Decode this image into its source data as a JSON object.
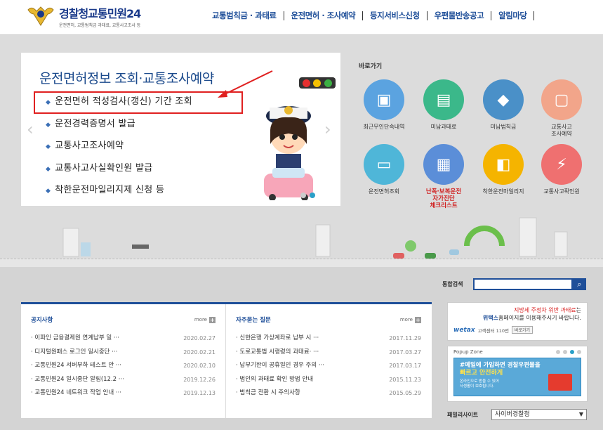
{
  "header": {
    "logo_title_a": "경찰청",
    "logo_title_b": "교통민원24",
    "logo_sub": "운전면허, 교통범칙금 과태료, 교통사고조사 등",
    "nav": [
      "교통범칙금 · 과태료",
      "운전면허 · 조사예약",
      "등지서비스신청",
      "우편물반송공고",
      "알림마당"
    ]
  },
  "banner": {
    "title": "운전면허정보 조회·교통조사예약",
    "items": [
      "운전면허 적성검사(갱신) 기간 조회",
      "운전경력증명서 발급",
      "교통사고조사예약",
      "교통사고사실확인원 발급",
      "착한운전마일리지제 신청 등"
    ],
    "prev_icon": "chevron-left-icon",
    "next_icon": "chevron-right-icon"
  },
  "quick": {
    "title": "바로가기",
    "items": [
      {
        "label": "최근무인단속내역",
        "icon": "camera-icon",
        "color": "#5ba3e0"
      },
      {
        "label": "미납과태료",
        "icon": "money-icon",
        "color": "#3bb88a"
      },
      {
        "label": "미납범칙금",
        "icon": "warning-icon",
        "color": "#4a90c8"
      },
      {
        "label": "교통사고\n조사예약",
        "icon": "computer-icon",
        "color": "#f2a58a"
      },
      {
        "label": "운전면허조회",
        "icon": "id-card-icon",
        "color": "#4fb6d8"
      },
      {
        "label": "난폭·보복운전\n자가진단\n체크리스트",
        "icon": "checklist-icon",
        "color": "#5b8ed8"
      },
      {
        "label": "착한운전마일리지",
        "icon": "mileage-icon",
        "color": "#f5b400"
      },
      {
        "label": "교통사고확인원",
        "icon": "accident-icon",
        "color": "#ef7070"
      }
    ]
  },
  "search": {
    "label": "통합검색",
    "placeholder": "",
    "button_icon": "search-icon"
  },
  "notices": {
    "title": "공지사항",
    "more": "more",
    "rows": [
      {
        "title": "이파인 금융결제원 연계납부 일 ···",
        "date": "2020.02.27"
      },
      {
        "title": "디지털원패스 로그인 일시중단 ···",
        "date": "2020.02.21"
      },
      {
        "title": "교통민원24 서버부하 테스트 안 ···",
        "date": "2020.02.10"
      },
      {
        "title": "교통민원24 일시중단 알림(12.2 ···",
        "date": "2019.12.26"
      },
      {
        "title": "교통민원24 네트워크 작업 안내 ···",
        "date": "2019.12.13"
      }
    ]
  },
  "faq": {
    "title": "자주묻는 질문",
    "more": "more",
    "rows": [
      {
        "title": "신한은행 가상계좌로 납부 시 ···",
        "date": "2017.11.29"
      },
      {
        "title": "도로교통법 시행령의 과태료· ···",
        "date": "2017.03.27"
      },
      {
        "title": "납부기한이 공휴일인 경우 주의 ···",
        "date": "2017.03.17"
      },
      {
        "title": "범인의 과태료 확인 방법 안내",
        "date": "2015.11.23"
      },
      {
        "title": "범칙금 전환 시 주의사항",
        "date": "2015.05.29"
      }
    ]
  },
  "ad": {
    "line1_red": "지방세 주정차 위반 과태료",
    "line1_rest": "는",
    "line2_blue": "위택스",
    "line2_rest": "홈페이지를 이용해주시기 바랍니다.",
    "brand": "wetax",
    "center": "고객센터 110번",
    "shortcut": "바로가기"
  },
  "popup": {
    "title": "Popup Zone",
    "line1": "#메일에 가입하면 경찰우편물을",
    "line2": "빠르고 안전하게",
    "line3": "온라인으로 받을 수 있어\n사생활이 보호됩니다."
  },
  "family": {
    "label": "패밀리사이트",
    "selected": "사이버경찰청"
  }
}
